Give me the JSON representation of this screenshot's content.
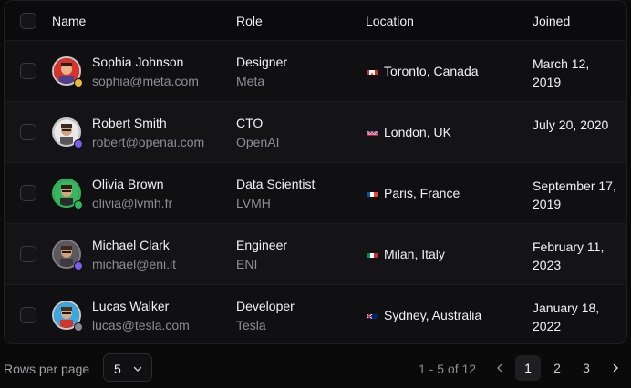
{
  "table": {
    "headers": {
      "name": "Name",
      "role": "Role",
      "location": "Location",
      "joined": "Joined"
    },
    "rows": [
      {
        "name": "Sophia Johnson",
        "email": "sophia@meta.com",
        "role": "Designer",
        "company": "Meta",
        "location": "Toronto, Canada",
        "flag": "canada-flag-icon",
        "joined": "March 12, 2019",
        "status_color": "#e5b93a",
        "avatar_ring": "#c9c9c9"
      },
      {
        "name": "Robert Smith",
        "email": "robert@openai.com",
        "role": "CTO",
        "company": "OpenAI",
        "location": "London, UK",
        "flag": "uk-flag-icon",
        "joined": "July 20, 2020",
        "status_color": "#7a5cf0",
        "avatar_ring": "#c9c9c9"
      },
      {
        "name": "Olivia Brown",
        "email": "olivia@lvmh.fr",
        "role": "Data Scientist",
        "company": "LVMH",
        "location": "Paris, France",
        "flag": "france-flag-icon",
        "joined": "September 17, 2019",
        "status_color": "#2fb85a",
        "avatar_ring": "#2fb85a"
      },
      {
        "name": "Michael Clark",
        "email": "michael@eni.it",
        "role": "Engineer",
        "company": "ENI",
        "location": "Milan, Italy",
        "flag": "italy-flag-icon",
        "joined": "February 11, 2023",
        "status_color": "#7a5cf0",
        "avatar_ring": "#7d7d82"
      },
      {
        "name": "Lucas Walker",
        "email": "lucas@tesla.com",
        "role": "Developer",
        "company": "Tesla",
        "location": "Sydney, Australia",
        "flag": "australia-flag-icon",
        "joined": "January 18, 2022",
        "status_color": "#8a8a90",
        "avatar_ring": "#c9c9c9"
      }
    ]
  },
  "footer": {
    "rows_per_page_label": "Rows per page",
    "rows_per_page_value": "5",
    "range_text": "1 - 5 of 12",
    "pages": [
      "1",
      "2",
      "3"
    ],
    "current_page": "1"
  }
}
